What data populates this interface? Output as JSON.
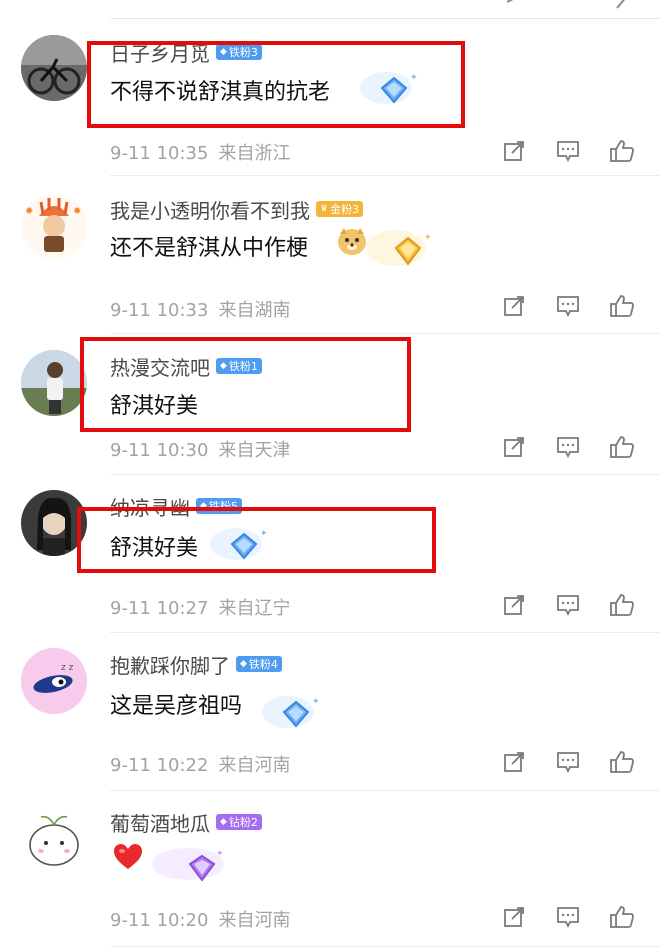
{
  "colors": {
    "badge_iron": "#4f9bf0",
    "badge_gold": "#f4b43a",
    "badge_diamond": "#a56bf0",
    "highlight_box": "#e10d0d",
    "meta_text": "#a3a3a3"
  },
  "comments": [
    {
      "username": "日子乡月觅",
      "badge": {
        "label": "铁粉3",
        "icon": "diamond-icon",
        "color": "#4f9bf0"
      },
      "text": "不得不说舒淇真的抗老",
      "time": "9-11 10:35",
      "location": "来自浙江"
    },
    {
      "username": "我是小透明你看不到我",
      "badge": {
        "label": "金粉3",
        "icon": "crown-icon",
        "color": "#f4b43a"
      },
      "text": "还不是舒淇从中作梗",
      "time": "9-11 10:33",
      "location": "来自湖南"
    },
    {
      "username": "热漫交流吧",
      "badge": {
        "label": "铁粉1",
        "icon": "diamond-icon",
        "color": "#4f9bf0"
      },
      "text": "舒淇好美",
      "time": "9-11 10:30",
      "location": "来自天津"
    },
    {
      "username": "纳凉寻幽",
      "badge": {
        "label": "铁粉5",
        "icon": "diamond-icon",
        "color": "#4f9bf0"
      },
      "text": "舒淇好美",
      "time": "9-11 10:27",
      "location": "来自辽宁"
    },
    {
      "username": "抱歉踩你脚了",
      "badge": {
        "label": "铁粉4",
        "icon": "diamond-icon",
        "color": "#4f9bf0"
      },
      "text": "这是吴彦祖吗",
      "time": "9-11 10:22",
      "location": "来自河南"
    },
    {
      "username": "葡萄酒地瓜",
      "badge": {
        "label": "钻粉2",
        "icon": "gem-icon",
        "color": "#a56bf0"
      },
      "text": "",
      "emoji": "red-heart",
      "time": "9-11 10:20",
      "location": "来自河南"
    }
  ],
  "actions": [
    "share-icon",
    "comment-icon",
    "like-icon"
  ]
}
